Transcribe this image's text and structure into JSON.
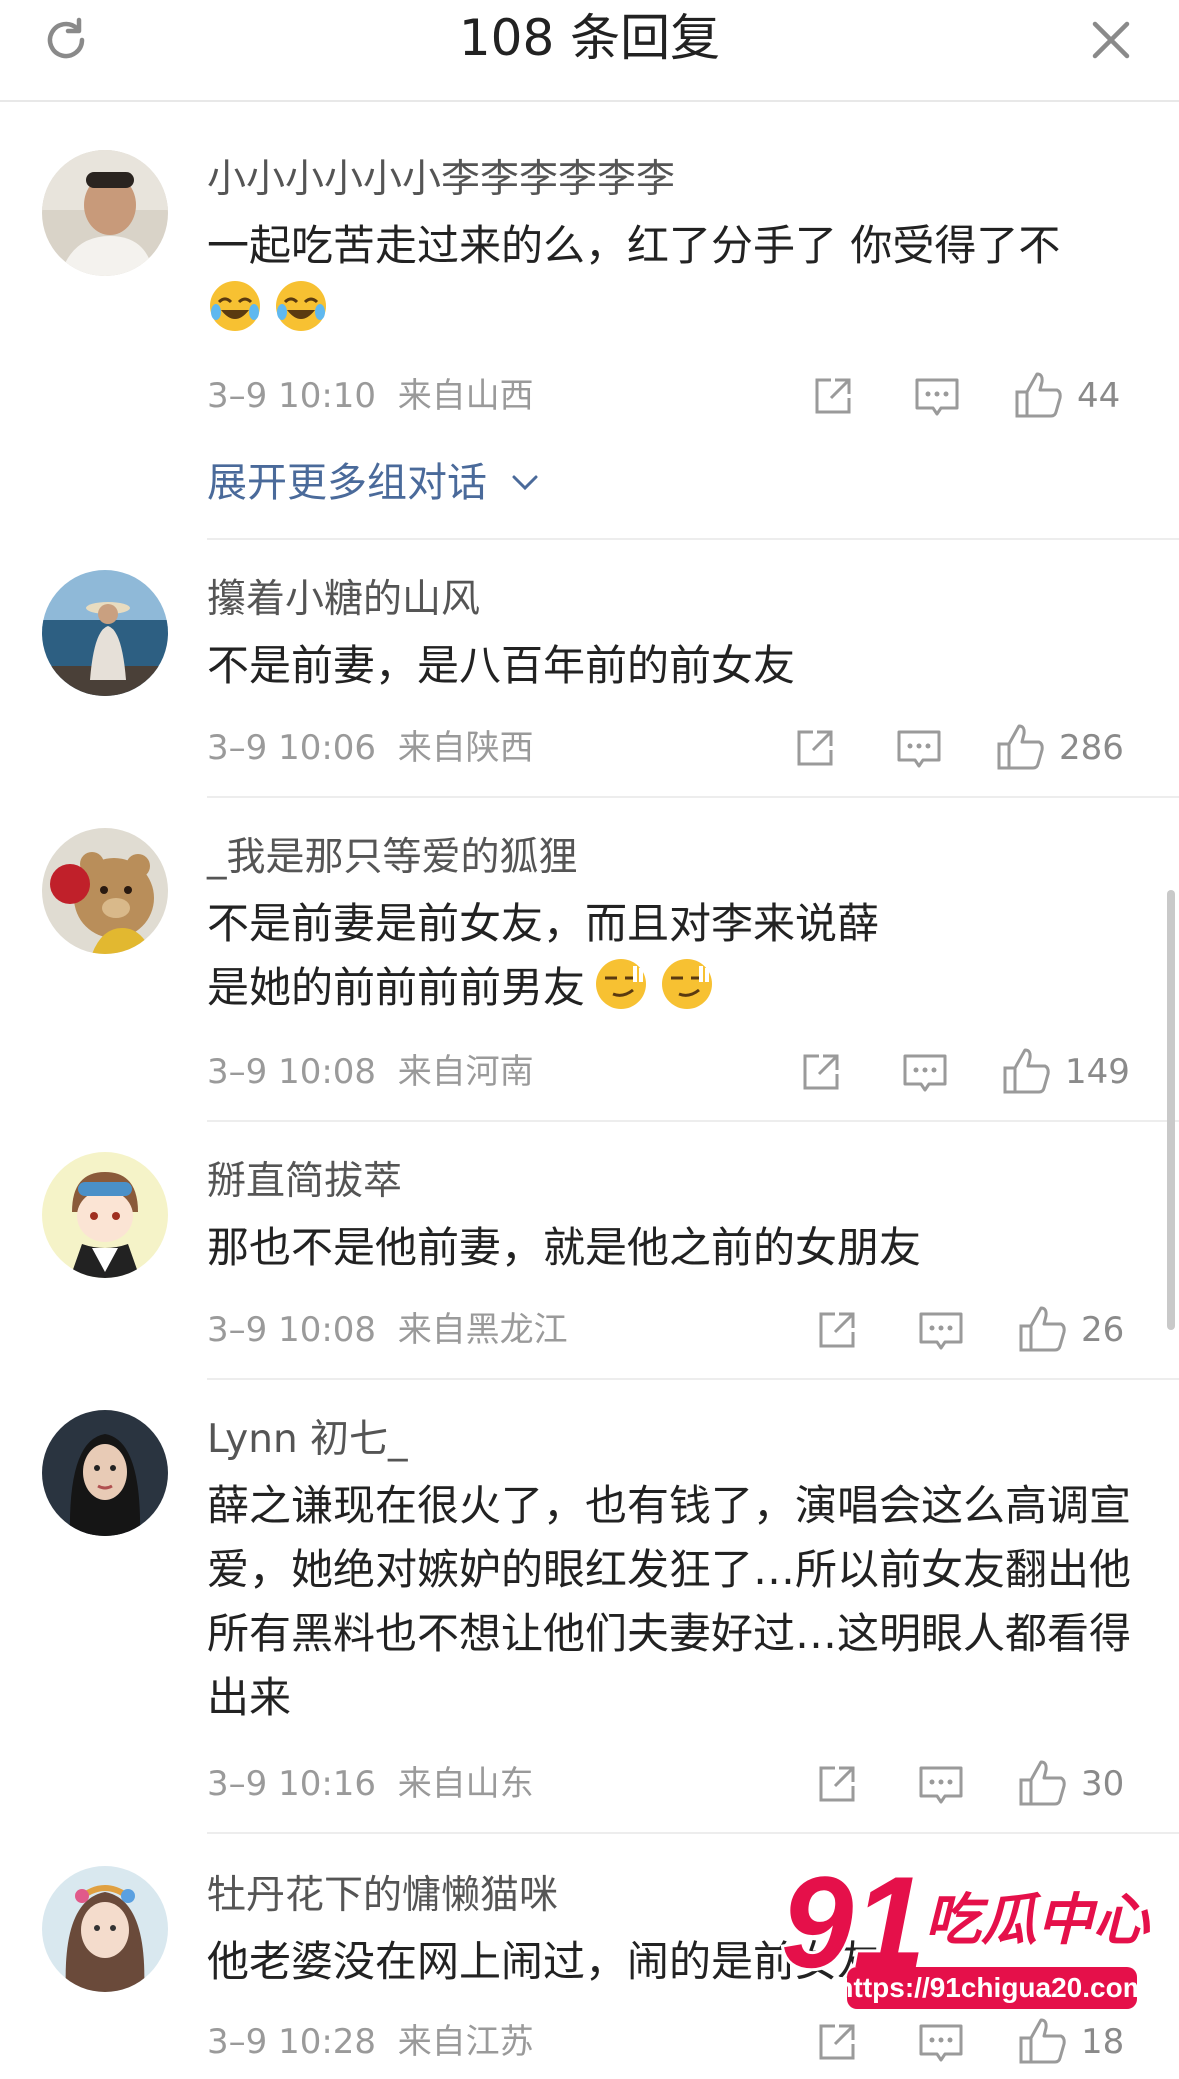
{
  "header": {
    "title": "108 条回复"
  },
  "comments": [
    {
      "username": "小小小小小小李李李李李李",
      "content": "一起吃苦走过来的么，红了分手了 你受得了不",
      "emojis": [
        "crying-laughing",
        "crying-laughing"
      ],
      "time": "3–9 10:10",
      "location": "来自山西",
      "likes": "44",
      "expand_label": "展开更多组对话"
    },
    {
      "username": "攥着小糖的山风",
      "content": "不是前妻，是八百年前的前女友",
      "time": "3–9 10:06",
      "location": "来自陕西",
      "likes": "286"
    },
    {
      "username": "_我是那只等爱的狐狸",
      "content": "不是前妻是前女友，而且对李来说薛是她的前前前前男友",
      "emojis": [
        "smirk",
        "smirk"
      ],
      "time": "3–9 10:08",
      "location": "来自河南",
      "likes": "149"
    },
    {
      "username": "掰直简拔萃",
      "content": "那也不是他前妻，就是他之前的女朋友",
      "time": "3–9 10:08",
      "location": "来自黑龙江",
      "likes": "26"
    },
    {
      "username": "Lynn 初七_",
      "content": "薛之谦现在很火了，也有钱了，演唱会这么高调宣爱，她绝对嫉妒的眼红发狂了…所以前女友翻出他所有黑料也不想让他们夫妻好过…这明眼人都看得出来",
      "time": "3–9 10:16",
      "location": "来自山东",
      "likes": "30"
    },
    {
      "username": "牡丹花下的慵懒猫咪",
      "content": "他老婆没在网上闹过，闹的是前女友",
      "time": "3–9 10:28",
      "location": "来自江苏",
      "likes": "18"
    }
  ],
  "watermark": {
    "logo_text": "91吃瓜中心",
    "url": "https://91chigua20.com"
  },
  "colors": {
    "link": "#4a6a9a",
    "meta": "#9a9a9a",
    "text": "#222222",
    "divider": "#ededed"
  }
}
